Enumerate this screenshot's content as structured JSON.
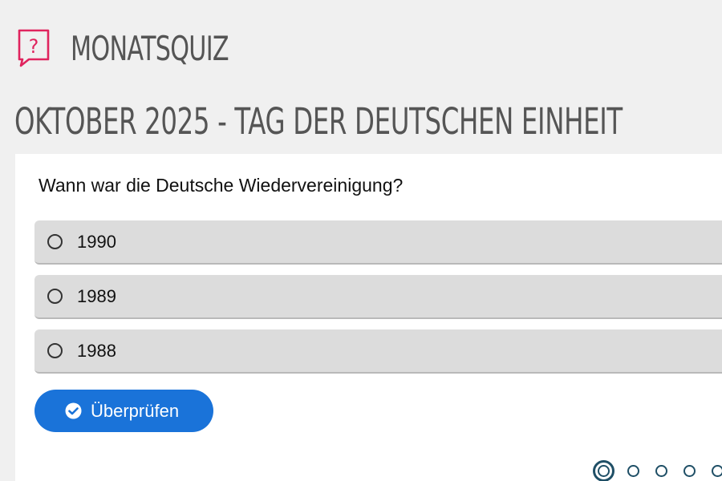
{
  "header": {
    "app_title": "MONATSQUIZ",
    "icon": "question-bubble-icon",
    "icon_color": "#e0245e"
  },
  "page_title": "OKTOBER 2025 - TAG DER DEUTSCHEN EINHEIT",
  "quiz": {
    "question": "Wann war die Deutsche Wiedervereinigung?",
    "answers": [
      {
        "label": "1990"
      },
      {
        "label": "1989"
      },
      {
        "label": "1988"
      }
    ],
    "check_button": {
      "label": "Überprüfen",
      "icon": "check-circle-icon",
      "color": "#1a73d9"
    }
  },
  "pagination": {
    "current_page": 1,
    "active_color": "#1f4f66"
  },
  "colors": {
    "background": "#f0f0f0",
    "card": "#ffffff",
    "answer_bg": "#dcdcdc",
    "title_text": "#555555"
  }
}
